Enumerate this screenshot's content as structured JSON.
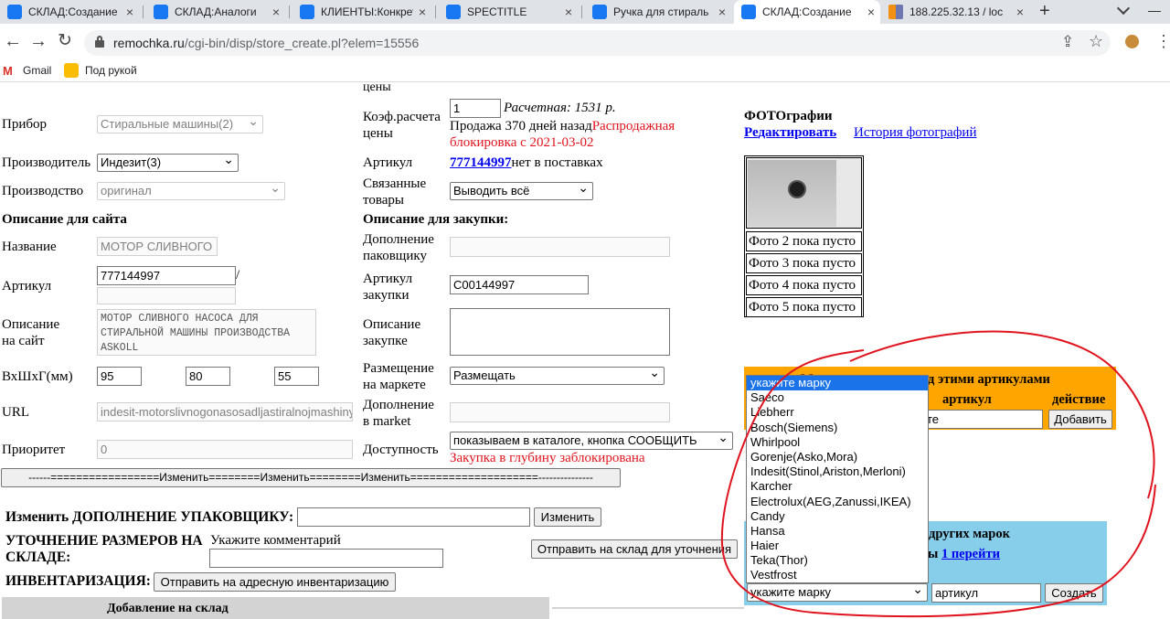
{
  "browser": {
    "tabs": [
      {
        "label": "СКЛАД:Создание"
      },
      {
        "label": "СКЛАД:Аналоги"
      },
      {
        "label": "КЛИЕНТЫ:Конкрет"
      },
      {
        "label": "SPECTITLE"
      },
      {
        "label": "Ручка для стираль"
      },
      {
        "label": "СКЛАД:Создание"
      },
      {
        "label": "188.225.32.13 / loc"
      }
    ],
    "new_tab": "+",
    "close": "×",
    "url_host": "remochka.ru",
    "url_path": "/cgi-bin/disp/store_create.pl?elem=15556",
    "bookmarks": [
      {
        "label": "Gmail"
      },
      {
        "label": "Под рукой"
      }
    ]
  },
  "left": {
    "prev_fragment": "цены",
    "pribor_label": "Прибор",
    "pribor_value": "Стиральные машины(2)",
    "manufacturer_label": "Производитель",
    "manufacturer_value": "Индезит(3)",
    "production_label": "Производство",
    "production_value": "оригинал",
    "site_desc_heading": "Описание для сайта",
    "name_label": "Название",
    "name_value": "МОТОР СЛИВНОГО",
    "article_label": "Артикул",
    "article_value": "777144997",
    "article_slash": "/",
    "desc_label_1": "Описание",
    "desc_label_2": "на сайт",
    "desc_value": "МОТОР СЛИВНОГО НАСОСА ДЛЯ\nСТИРАЛЬНОЙ МАШИНЫ ПРОИЗВОДСТВА\nASKOLL",
    "dims_label": "ВхШхГ(мм)",
    "dims": [
      "95",
      "80",
      "55"
    ],
    "url_label": "URL",
    "url_value": "indesit-motorslivnogonasosadljastiralnojmashiny",
    "priority_label": "Приоритет",
    "priority_value": "0",
    "change_all_button": "------=================Изменить========Изменить========Изменить====================---------------"
  },
  "mid": {
    "coef_label_1": "Коэф.расчета",
    "coef_label_2": "цены",
    "coef_value": "1",
    "calc_price": "Расчетная: 1531 р.",
    "sale_text": "Продажа 370 дней назад",
    "sale_red_1": "Распродажная",
    "sale_red_2": "блокировка с 2021-03-02",
    "article_label": "Артикул",
    "article_link": "777144997",
    "article_note": "нет в поставках",
    "related_label_1": "Связанные",
    "related_label_2": "товары",
    "related_value": "Выводить всё",
    "purchase_heading": "Описание для закупки:",
    "packer_label_1": "Дополнение",
    "packer_label_2": "паковщику",
    "purchase_art_label_1": "Артикул",
    "purchase_art_label_2": "закупки",
    "purchase_art_value": "C00144997",
    "purchase_desc_label_1": "Описание",
    "purchase_desc_label_2": "закупке",
    "market_label_1": "Размещение",
    "market_label_2": "на маркете",
    "market_value": "Размещать",
    "market_add_label_1": "Дополнение",
    "market_add_label_2": "в market",
    "avail_label": "Доступность",
    "avail_value": "показываем в каталоге, кнопка СООБЩИТЬ",
    "avail_red": "Закупка в глубину заблокирована"
  },
  "bottom": {
    "packer_add_label": "Изменить ДОПОЛНЕНИЕ УПАКОВЩИКУ:",
    "packer_add_button": "Изменить",
    "dims_clarify_label_1": "УТОЧНЕНИЕ РАЗМЕРОВ НА",
    "dims_clarify_label_2": "СКЛАДЕ:",
    "comment_hint": "Укажите комментарий",
    "send_clarify_button": "Отправить на склад для уточнения",
    "inventory_label": "ИНВЕНТАРИЗАЦИЯ:",
    "inventory_button": "Отправить на адресную инвентаризацию",
    "add_to_stock": "Добавление на склад"
  },
  "photos": {
    "heading": "ФОТОграфии",
    "edit_link_a": "Ре",
    "edit_link_b": "дактировать",
    "history_link": "История фотографий",
    "empty_slots": [
      "Фото 2 пока пусто",
      "Фото 3 пока пусто",
      "Фото 4 пока пусто",
      "Фото 5 пока пусто"
    ]
  },
  "right_panel": {
    "orange_heading_a": "М",
    "orange_heading_b": "д этими артикулами",
    "col_article": "артикул",
    "col_action": "действие",
    "input_fragment": "те",
    "add_button": "Добавить",
    "blue_heading": "других марок",
    "blue_fragment": "ы",
    "blue_link": "1 перейти",
    "brand_select": "укажите марку",
    "article_input": "артикул",
    "create_button": "Создать"
  },
  "brand_dropdown": {
    "options": [
      "укажите марку",
      "Saeco",
      "Liebherr",
      "Bosch(Siemens)",
      "Whirlpool",
      "Gorenje(Asko,Mora)",
      "Indesit(Stinol,Ariston,Merloni)",
      "Karcher",
      "Electrolux(AEG,Zanussi,IKEA)",
      "Candy",
      "Hansa",
      "Haier",
      "Teka(Thor)",
      "Vestfrost"
    ],
    "selected_index": 0
  },
  "colors": {
    "orange_panel": "#ffa500",
    "blue_panel": "#87ceeb",
    "annotation": "#e0141e",
    "link": "#0000ee"
  }
}
